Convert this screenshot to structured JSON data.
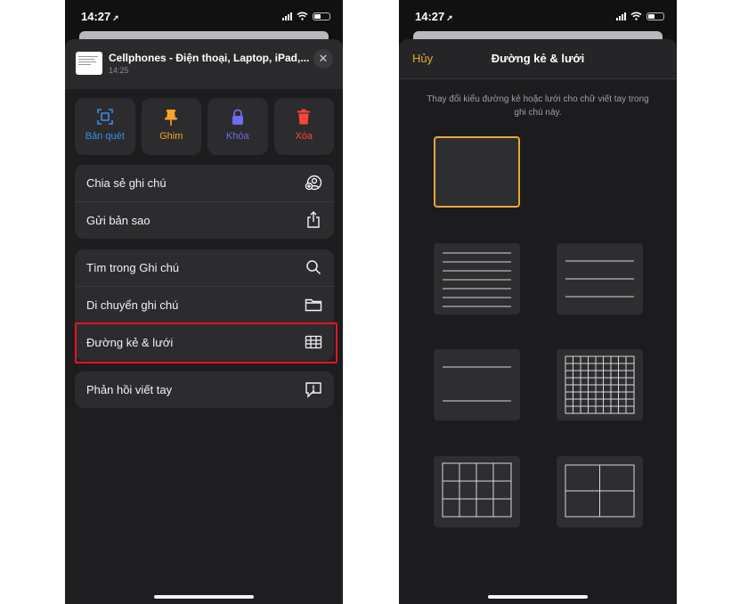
{
  "status_bar": {
    "time": "14:27",
    "location_glyph": "➚"
  },
  "left_screen": {
    "share_header": {
      "title": "Cellphones - Điện thoại, Laptop, iPad,...",
      "subtitle": "14:25",
      "close_glyph": "✕"
    },
    "quick_actions": [
      {
        "label": "Bản quét",
        "icon": "scan-icon",
        "color": "#3d8bf2"
      },
      {
        "label": "Ghim",
        "icon": "pin-icon",
        "color": "#f5a524"
      },
      {
        "label": "Khóa",
        "icon": "lock-icon",
        "color": "#6e6cf0"
      },
      {
        "label": "Xóa",
        "icon": "trash-icon",
        "color": "#ff453a"
      }
    ],
    "menu_group_1": [
      {
        "label": "Chia sẻ ghi chú",
        "icon": "share-note-icon"
      },
      {
        "label": "Gửi bản sao",
        "icon": "share-upload-icon"
      }
    ],
    "menu_group_2": [
      {
        "label": "Tìm trong Ghi chú",
        "icon": "search-icon"
      },
      {
        "label": "Di chuyển ghi chú",
        "icon": "folder-icon"
      },
      {
        "label": "Đường kẻ & lưới",
        "icon": "grid-icon"
      }
    ],
    "menu_group_3": [
      {
        "label": "Phản hồi viết tay",
        "icon": "feedback-icon"
      }
    ]
  },
  "right_screen": {
    "nav": {
      "cancel_label": "Hủy",
      "title": "Đường kẻ & lưới"
    },
    "description": "Thay đổi kiểu đường kẻ hoặc lưới cho chữ viết tay trong ghi chú này.",
    "options": [
      {
        "style": "none",
        "selected": true
      },
      {
        "style": "small-lines",
        "selected": false
      },
      {
        "style": "medium-lines",
        "selected": false
      },
      {
        "style": "large-lines",
        "selected": false
      },
      {
        "style": "small-grid",
        "selected": false
      },
      {
        "style": "medium-grid",
        "selected": false
      },
      {
        "style": "large-grid",
        "selected": false
      }
    ]
  },
  "colors": {
    "accent": "#e4a935",
    "highlight": "#e1171d"
  }
}
